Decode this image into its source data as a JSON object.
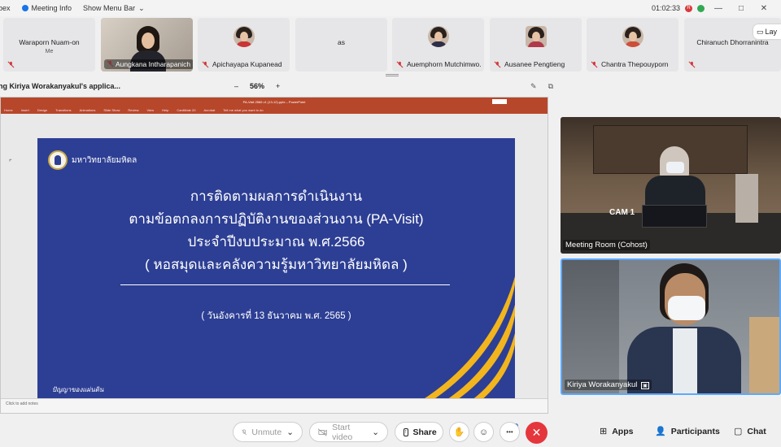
{
  "topbar": {
    "app_fragment": "bex",
    "meeting_info": "Meeting Info",
    "show_menu_bar": "Show Menu Bar",
    "timer": "01:02:33",
    "badge": "R"
  },
  "participants": [
    {
      "name": "Waraporn Nuam-on",
      "sub": "Me",
      "type": "text"
    },
    {
      "name": "Aungkana Intharapanich",
      "type": "video"
    },
    {
      "name": "Apichayapa Kupanead",
      "type": "avatar"
    },
    {
      "name": "as",
      "type": "text"
    },
    {
      "name": "Auemphorn Mutchimwo...",
      "type": "avatar"
    },
    {
      "name": "Ausanee Pengtieng",
      "type": "avatar"
    },
    {
      "name": "Chantra Thepouyporn",
      "type": "avatar"
    },
    {
      "name": "Chiranuch Dhorranintra",
      "type": "text"
    }
  ],
  "layout_label": "Lay",
  "share": {
    "title": "ng Kiriya Worakanyakul's applica...",
    "zoom_minus": "–",
    "zoom": "56%",
    "zoom_plus": "+"
  },
  "ppt": {
    "window_title": "PA-Visit 2566 v1 (13-12).pptx – PowerPoint",
    "ribbon": [
      "Home",
      "Insert",
      "Design",
      "Transitions",
      "Animations",
      "Slide Show",
      "Review",
      "View",
      "Help",
      "CardMate 20",
      "Acrobat",
      "Tell me what you want to do"
    ],
    "notes_placeholder": "Click to add notes"
  },
  "slide": {
    "org": "มหาวิทยาลัยมหิดล",
    "lines": [
      "การติดตามผลการดำเนินงาน",
      "ตามข้อตกลงการปฏิบัติงานของส่วนงาน (PA-Visit)",
      "ประจำปีงบประมาณ พ.ศ.2566",
      "( หอสมุดและคลังความรู้มหาวิทยาลัยมหิดล )"
    ],
    "date": "( วันอังคารที่ 13 ธันวาคม พ.ศ. 2565 )",
    "signature": "ปัญญาของแผ่นดิน"
  },
  "videos": {
    "room_label": "Meeting Room (Cohost)",
    "cam_text": "CAM 1",
    "speaker_label": "Kiriya Worakanyakul"
  },
  "controls": {
    "unmute": "Unmute",
    "start_video": "Start video",
    "share": "Share",
    "more": "•••",
    "apps": "Apps",
    "participants": "Participants",
    "chat": "Chat"
  }
}
